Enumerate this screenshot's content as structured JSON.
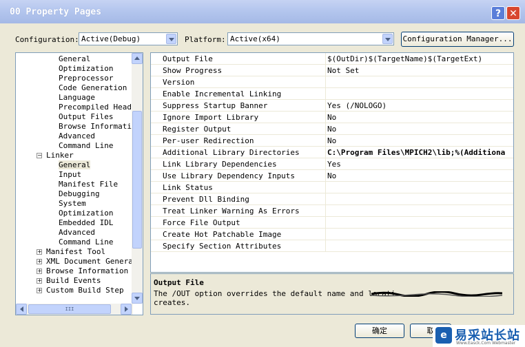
{
  "window": {
    "title": "00 Property Pages"
  },
  "config": {
    "configuration_label": "Configuration:",
    "configuration_value": "Active(Debug)",
    "platform_label": "Platform:",
    "platform_value": "Active(x64)",
    "manager_button": "Configuration Manager..."
  },
  "tree": [
    {
      "label": "General",
      "indent": 2
    },
    {
      "label": "Optimization",
      "indent": 2
    },
    {
      "label": "Preprocessor",
      "indent": 2
    },
    {
      "label": "Code Generation",
      "indent": 2
    },
    {
      "label": "Language",
      "indent": 2
    },
    {
      "label": "Precompiled Heade",
      "indent": 2
    },
    {
      "label": "Output Files",
      "indent": 2
    },
    {
      "label": "Browse Informatio",
      "indent": 2
    },
    {
      "label": "Advanced",
      "indent": 2
    },
    {
      "label": "Command Line",
      "indent": 2
    },
    {
      "label": "Linker",
      "indent": 1,
      "expander": "−"
    },
    {
      "label": "General",
      "indent": 2,
      "selected": true
    },
    {
      "label": "Input",
      "indent": 2
    },
    {
      "label": "Manifest File",
      "indent": 2
    },
    {
      "label": "Debugging",
      "indent": 2
    },
    {
      "label": "System",
      "indent": 2
    },
    {
      "label": "Optimization",
      "indent": 2
    },
    {
      "label": "Embedded IDL",
      "indent": 2
    },
    {
      "label": "Advanced",
      "indent": 2
    },
    {
      "label": "Command Line",
      "indent": 2
    },
    {
      "label": "Manifest Tool",
      "indent": 1,
      "expander": "+"
    },
    {
      "label": "XML Document Generat",
      "indent": 1,
      "expander": "+"
    },
    {
      "label": "Browse Information",
      "indent": 1,
      "expander": "+"
    },
    {
      "label": "Build Events",
      "indent": 1,
      "expander": "+"
    },
    {
      "label": "Custom Build Step",
      "indent": 1,
      "expander": "+"
    }
  ],
  "tree_hscroll_label": "III",
  "properties": [
    {
      "name": "Output File",
      "value": "$(OutDir)$(TargetName)$(TargetExt)"
    },
    {
      "name": "Show Progress",
      "value": "Not Set"
    },
    {
      "name": "Version",
      "value": ""
    },
    {
      "name": "Enable Incremental Linking",
      "value": ""
    },
    {
      "name": "Suppress Startup Banner",
      "value": "Yes (/NOLOGO)"
    },
    {
      "name": "Ignore Import Library",
      "value": "No"
    },
    {
      "name": "Register Output",
      "value": "No"
    },
    {
      "name": "Per-user Redirection",
      "value": "No"
    },
    {
      "name": "Additional Library Directories",
      "value": "C:\\Program Files\\MPICH2\\lib;%(Additiona",
      "bold": true
    },
    {
      "name": "Link Library Dependencies",
      "value": "Yes"
    },
    {
      "name": "Use Library Dependency Inputs",
      "value": "No"
    },
    {
      "name": "Link Status",
      "value": ""
    },
    {
      "name": "Prevent Dll Binding",
      "value": ""
    },
    {
      "name": "Treat Linker Warning As Errors",
      "value": ""
    },
    {
      "name": "Force File Output",
      "value": ""
    },
    {
      "name": "Create Hot Patchable Image",
      "value": ""
    },
    {
      "name": "Specify Section Attributes",
      "value": ""
    }
  ],
  "description": {
    "title": "Output File",
    "text": "The /OUT option overrides the default name and locati creates."
  },
  "buttons": {
    "ok": "确定",
    "cancel": "取"
  },
  "watermark": {
    "text": "易采站长站",
    "sub": "Www.Easck.Com Webmaster",
    "icon": "e"
  },
  "colors": {
    "titlebar": "#b4c6ee",
    "selection": "#ece9d8"
  }
}
